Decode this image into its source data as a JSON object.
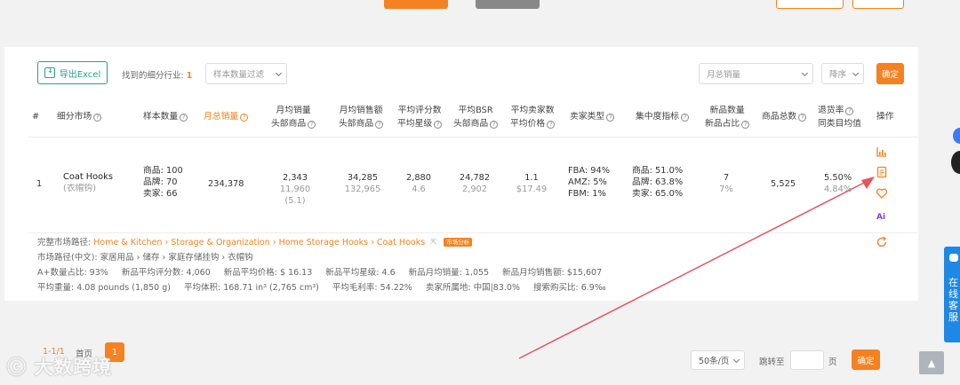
{
  "top_buttons": {
    "b1": "",
    "b2": "",
    "b3": "",
    "b4": ""
  },
  "toolbar": {
    "export_label": "导出Excel",
    "found_label": "找到的细分行业:",
    "found_count": "1",
    "sample_filter_placeholder": "样本数量过滤",
    "sort_field": "月总销量",
    "sort_order": "降序",
    "confirm": "确定"
  },
  "table": {
    "headers": {
      "index": "#",
      "market": "细分市场",
      "sample": "样本数量",
      "total_sales": "月总销量",
      "avg_sales_1": "月均销量",
      "avg_sales_2": "头部商品",
      "avg_revenue_1": "月均销售额",
      "avg_revenue_2": "头部商品",
      "avg_reviews_1": "平均评分数",
      "avg_reviews_2": "平均星级",
      "avg_bsr_1": "平均BSR",
      "avg_bsr_2": "头部商品",
      "avg_sellers_1": "平均卖家数",
      "avg_sellers_2": "平均价格",
      "seller_type": "卖家类型",
      "concentration": "集中度指标",
      "new_count_1": "新品数量",
      "new_count_2": "新品占比",
      "product_total": "商品总数",
      "return_1": "退货率",
      "return_2": "同类目均值",
      "actions": "操作"
    },
    "row": {
      "index": "1",
      "market_name": "Coat Hooks",
      "market_cn": "(衣帽钩)",
      "sample_products": "商品: 100",
      "sample_brands": "品牌: 70",
      "sample_sellers": "卖家: 66",
      "total_sales": "234,378",
      "avg_sales": "2,343",
      "avg_sales_top": "11,960 (5.1)",
      "avg_revenue": "34,285",
      "avg_revenue_top": "132,965",
      "avg_reviews": "2,880",
      "avg_rating": "4.6",
      "avg_bsr": "24,782",
      "avg_bsr_top": "2,902",
      "avg_sellers": "1.1",
      "avg_price": "$17.49",
      "fba": "FBA: 94%",
      "amz": "AMZ: 5%",
      "fbm": "FBM: 1%",
      "conc_products": "商品: 51.0%",
      "conc_brands": "品牌: 63.8%",
      "conc_sellers": "卖家: 65.0%",
      "new_count": "7",
      "new_ratio": "7%",
      "product_total": "5,525",
      "return_rate": "5.50%",
      "return_avg": "4.84%"
    },
    "details": {
      "path_label": "完整市场路径:",
      "path": [
        "Home & Kitchen",
        "Storage & Organization",
        "Home Storage Hooks",
        "Coat Hooks"
      ],
      "sep": "›",
      "tag": "市场分析",
      "path_cn_label": "市场路径(中文):",
      "path_cn": "家居用品 › 储存 › 家庭存储挂钩 › 衣帽钩",
      "line3": [
        "A+数量占比: 93%",
        "新品平均评分数: 4,060",
        "新品平均价格: $ 16.13",
        "新品平均星级: 4.6",
        "新品月均销量: 1,055",
        "新品月均销售额: $15,607"
      ],
      "line4": [
        "平均重量: 4.08 pounds (1,850 g)",
        "平均体积: 168.71 in³ (2,765 cm³)",
        "平均毛利率: 54.22%",
        "卖家所属地: 中国|83.0%",
        "搜索购买比: 6.9‰"
      ]
    }
  },
  "pagination": {
    "range": "1-1/1",
    "home": "首页",
    "current": "1",
    "page_size": "50条/页",
    "goto": "跳转至",
    "page_unit": "页",
    "confirm": "确定"
  },
  "float_panel": {
    "text": "在线客服"
  },
  "watermark": "大数跨境",
  "colors": {
    "accent": "#f58220",
    "teal": "#2aa08a",
    "arrow": "#e8545a",
    "float": "#1e88e5"
  }
}
